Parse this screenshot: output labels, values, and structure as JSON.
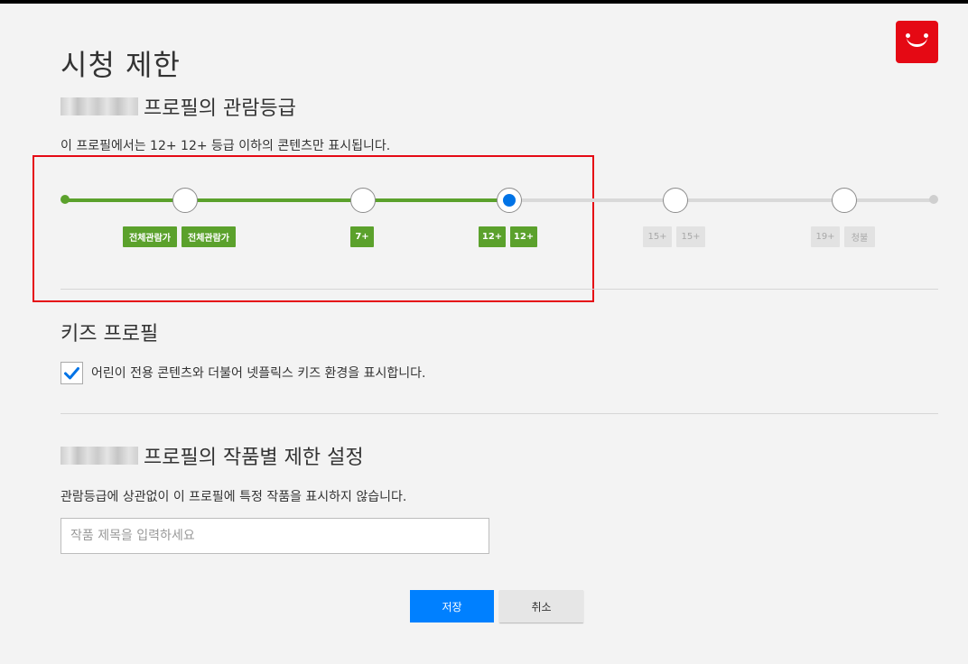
{
  "page": {
    "title": "시청 제한"
  },
  "maturity": {
    "heading_suffix": "프로필의 관람등급",
    "description": "이 프로필에서는 12+ 12+ 등급 이하의 콘텐츠만 표시됩니다.",
    "selected_level": "12+",
    "levels": [
      {
        "badges": [
          "전체관람가",
          "전체관람가"
        ],
        "active": true
      },
      {
        "badges": [
          "7+"
        ],
        "active": true
      },
      {
        "badges": [
          "12+",
          "12+"
        ],
        "active": true,
        "selected": true
      },
      {
        "badges": [
          "15+",
          "15+"
        ],
        "active": false
      },
      {
        "badges": [
          "19+",
          "청불"
        ],
        "active": false
      }
    ]
  },
  "kids": {
    "heading": "키즈 프로필",
    "checkbox_label": "어린이 전용 콘텐츠와 더불어 넷플릭스 키즈 환경을 표시합니다.",
    "checked": true
  },
  "title_restrictions": {
    "heading_suffix": "프로필의 작품별 제한 설정",
    "description": "관람등급에 상관없이 이 프로필에 특정 작품을 표시하지 않습니다.",
    "input_placeholder": "작품 제목을 입력하세요",
    "input_value": ""
  },
  "buttons": {
    "save": "저장",
    "cancel": "취소"
  },
  "colors": {
    "brand_red": "#e50914",
    "active_green": "#5ba12c",
    "selected_blue": "#0073e6",
    "save_blue": "#0080ff"
  },
  "icons": {
    "avatar": "smiley-avatar-icon",
    "checkbox": "checkmark-icon"
  }
}
